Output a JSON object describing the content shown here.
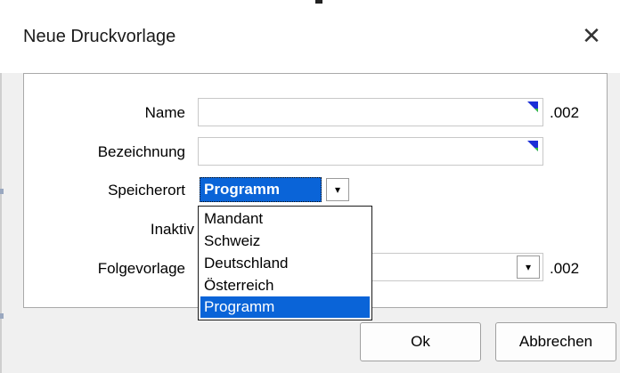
{
  "dialog": {
    "title": "Neue Druckvorlage",
    "close_glyph": "✕",
    "close_icon": "close-icon"
  },
  "form": {
    "name_label": "Name",
    "name_value": "",
    "name_suffix": ".002",
    "bezeichnung_label": "Bezeichnung",
    "bezeichnung_value": "",
    "speicherort_label": "Speicherort",
    "speicherort_value": "Programm",
    "inaktiv_label": "Inaktiv",
    "folgevorlage_label": "Folgevorlage",
    "folgevorlage_suffix": ".002"
  },
  "dropdown": {
    "options": [
      "Mandant",
      "Schweiz",
      "Deutschland",
      "Österreich",
      "Programm"
    ],
    "selected": "Programm"
  },
  "buttons": {
    "ok": "Ok",
    "cancel": "Abbrechen"
  },
  "icons": {
    "chevron": "▾",
    "corner_marker": "blue-green-corner-triangle"
  },
  "colors": {
    "selection": "#0a64d8",
    "marker_blue": "#1b2fd6",
    "marker_green": "#2fbf3a"
  }
}
